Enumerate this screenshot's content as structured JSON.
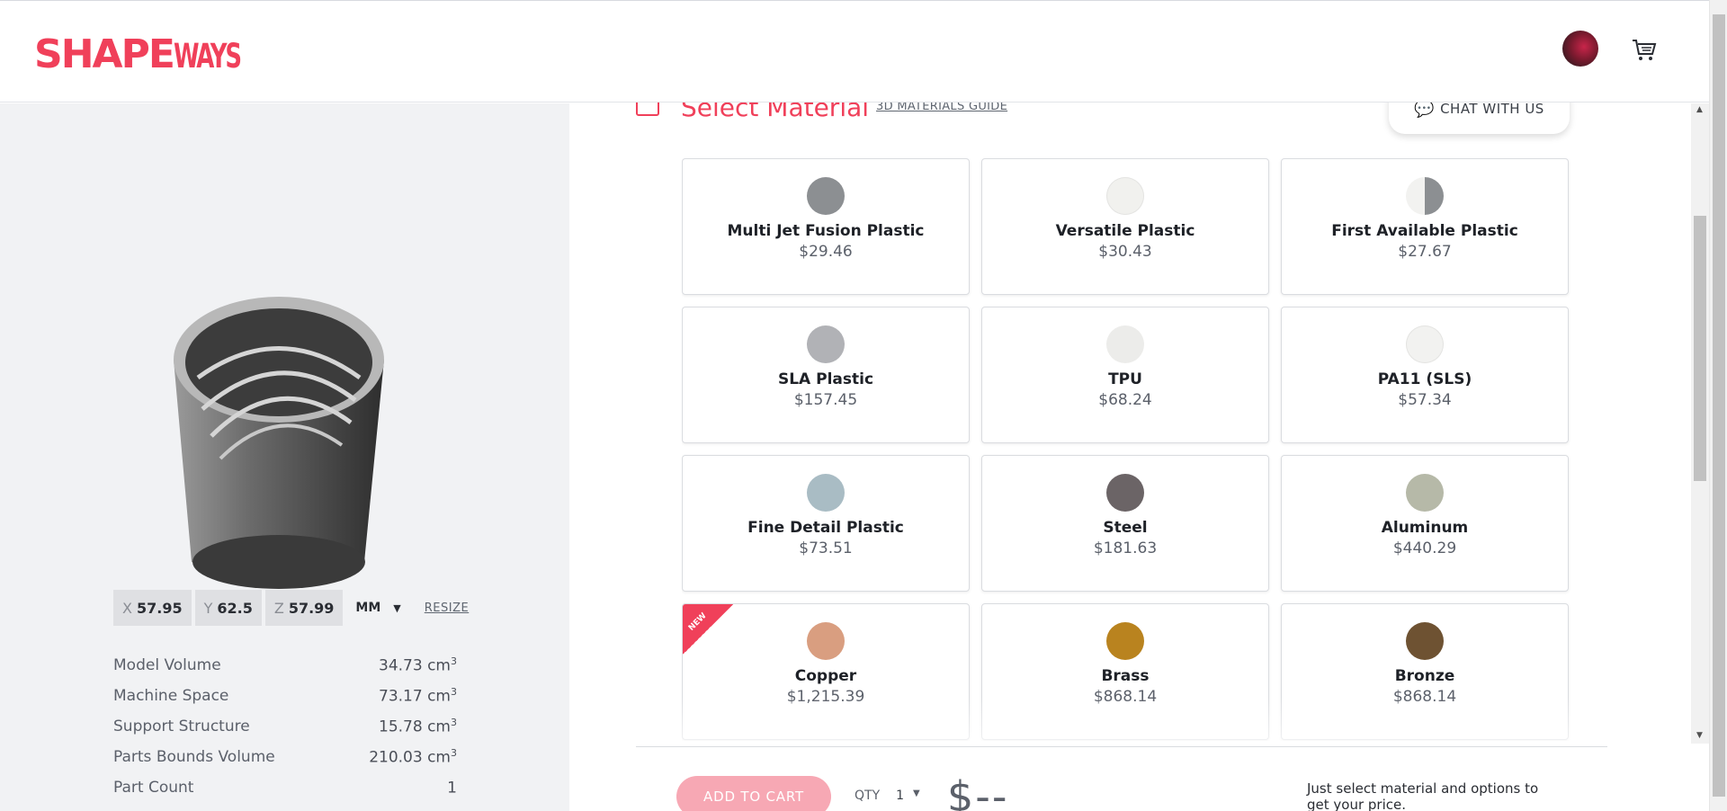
{
  "header": {
    "logo_main": "SHAPE",
    "logo_sub": "WAYS"
  },
  "dimensions": {
    "x_axis": "X",
    "x_value": "57.95",
    "y_axis": "Y",
    "y_value": "62.5",
    "z_axis": "Z",
    "z_value": "57.99",
    "unit": "MM",
    "resize_label": "RESIZE"
  },
  "stats": [
    {
      "label": "Model Volume",
      "value": "34.73 cm",
      "sup": "3"
    },
    {
      "label": "Machine Space",
      "value": "73.17 cm",
      "sup": "3"
    },
    {
      "label": "Support Structure",
      "value": "15.78 cm",
      "sup": "3"
    },
    {
      "label": "Parts Bounds Volume",
      "value": "210.03 cm",
      "sup": "3"
    },
    {
      "label": "Part Count",
      "value": "1",
      "sup": ""
    }
  ],
  "section": {
    "title": "Select Material",
    "guide_link": "3D MATERIALS GUIDE",
    "chat_label": "CHAT WITH US"
  },
  "materials": [
    {
      "name": "Multi Jet Fusion Plastic",
      "price": "$29.46",
      "swatch": "#8c8f92"
    },
    {
      "name": "Versatile Plastic",
      "price": "$30.43",
      "swatch": "#f1f1ee"
    },
    {
      "name": "First Available Plastic",
      "price": "$27.67",
      "swatch": "split"
    },
    {
      "name": "SLA Plastic",
      "price": "$157.45",
      "swatch": "#b1b2b6"
    },
    {
      "name": "TPU",
      "price": "$68.24",
      "swatch": "#ececea"
    },
    {
      "name": "PA11 (SLS)",
      "price": "$57.34",
      "swatch": "#f2f2f0"
    },
    {
      "name": "Fine Detail Plastic",
      "price": "$73.51",
      "swatch": "#a9bcc4"
    },
    {
      "name": "Steel",
      "price": "$181.63",
      "swatch": "#6b6466"
    },
    {
      "name": "Aluminum",
      "price": "$440.29",
      "swatch": "#b6b9a8"
    },
    {
      "name": "Copper",
      "price": "$1,215.39",
      "swatch": "#d99e80",
      "badge": "NEW"
    },
    {
      "name": "Brass",
      "price": "$868.14",
      "swatch": "#b9831f"
    },
    {
      "name": "Bronze",
      "price": "$868.14",
      "swatch": "#6e5232"
    }
  ],
  "footer": {
    "add_to_cart": "ADD TO CART",
    "qty_label": "QTY",
    "qty_value": "1",
    "price": "$--",
    "hint": "Just select material and options to get your price."
  }
}
